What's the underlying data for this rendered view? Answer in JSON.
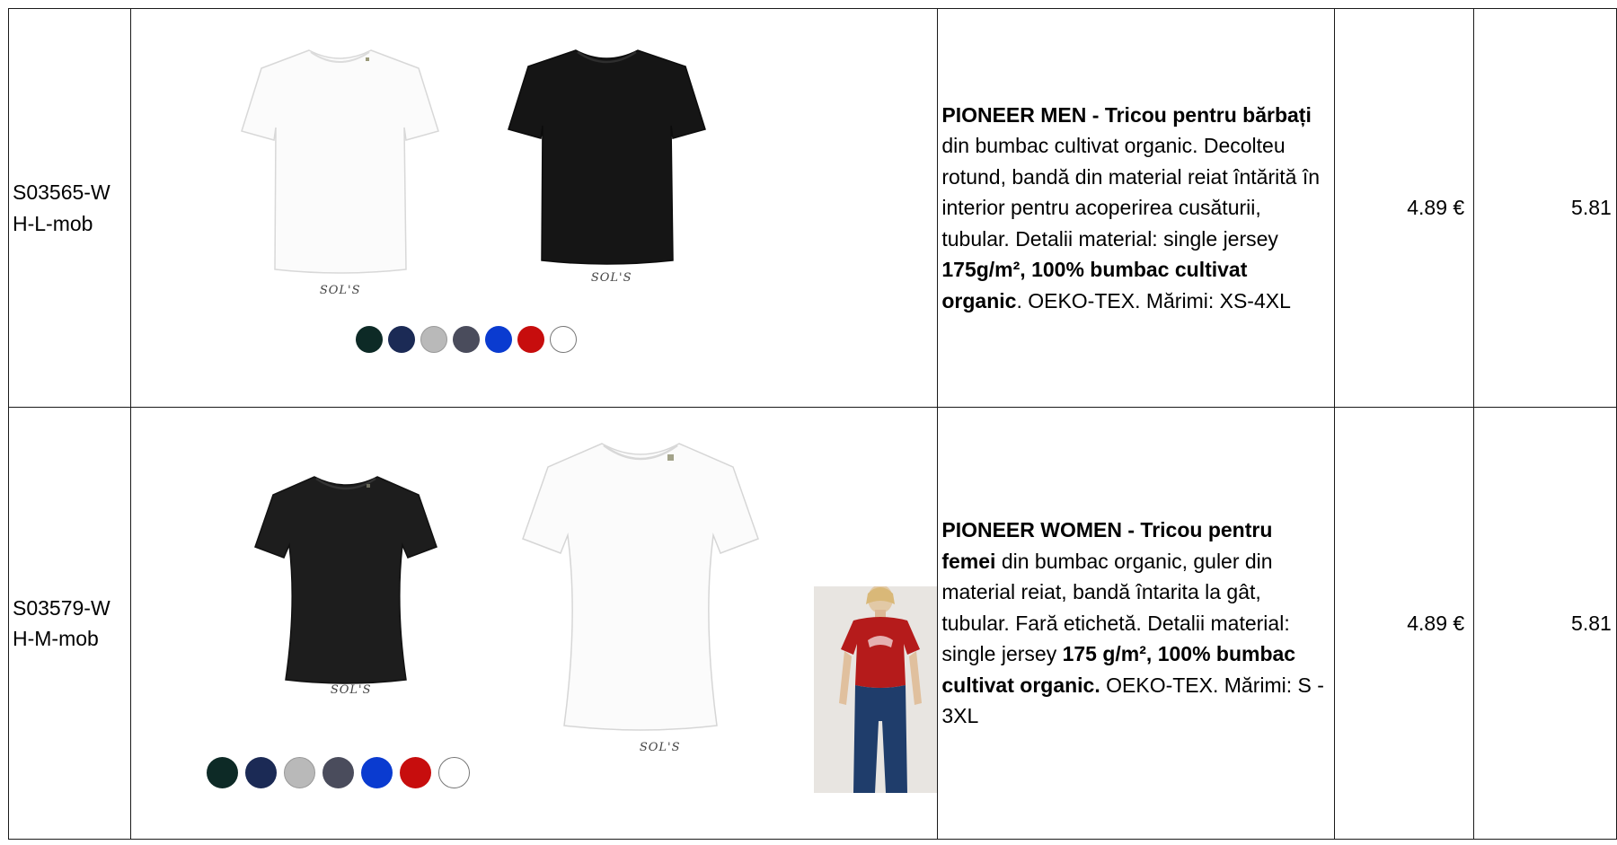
{
  "rows": [
    {
      "code": "S03565-WH-L-mob",
      "brand": "SOL'S",
      "description": {
        "title": "PIONEER MEN - Tricou pentru bărbați",
        "title_part1": "PIONEER MEN -  Tricou pentru ",
        "title_part2": "bărbați",
        "text1": " din bumbac cultivat organic. Decolteu rotund, bandă din material reiat întărită în interior pentru acoperirea cusăturii, tubular. Detalii material: single jersey ",
        "bold2": "175g/m², 100% bumbac cultivat organic",
        "text2": ". OEKO-TEX. Mărimi: XS-4XL"
      },
      "price1": "4.89  €",
      "price2": "5.81  €",
      "swatch_colors": [
        "#0d2a26",
        "#1b2a55",
        "#b9b9b9",
        "#4a4c5c",
        "#0a3bd0",
        "#c70d0d",
        "#ffffff"
      ]
    },
    {
      "code": "S03579-WH-M-mob",
      "brand": "SOL'S",
      "description": {
        "title_part1": "PIONEER WOMEN - Tricou pentru ",
        "title_part2": "femei",
        "text1": " din bumbac organic, guler din material reiat, bandă întarita la gât, tubular. Fară etichetă. Detalii material: single jersey ",
        "bold2": "175 g/m², 100% bumbac cultivat organic.",
        "text2": " OEKO-TEX. Mărimi: S - 3XL"
      },
      "price1": "4.89  €",
      "price2": "5.81  €",
      "swatch_colors": [
        "#0d2a26",
        "#1b2a55",
        "#b9b9b9",
        "#4a4c5c",
        "#0a3bd0",
        "#c70d0d",
        "#ffffff"
      ]
    }
  ],
  "icons": {
    "shirt_men_white": "tshirt-men-white-icon",
    "shirt_men_black": "tshirt-men-black-icon",
    "shirt_women_black": "tshirt-women-black-icon",
    "shirt_women_white": "tshirt-women-white-icon",
    "model_photo": "model-red-tshirt-photo"
  },
  "colors": {
    "border": "#1a1a1a",
    "black_shirt": "#151515",
    "white_shirt": "#fafafa",
    "red_shirt": "#b51b1b"
  }
}
